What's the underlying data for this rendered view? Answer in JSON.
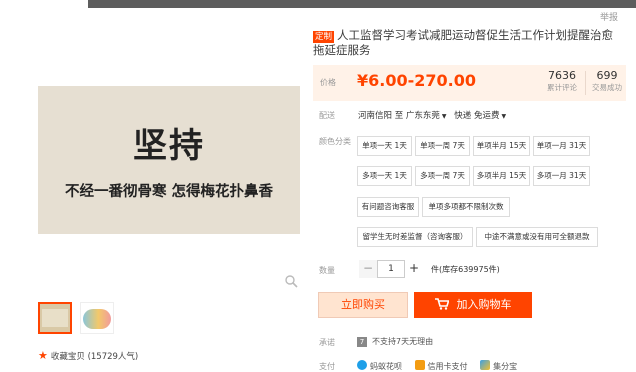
{
  "header": {
    "top_right_link": "举报"
  },
  "product": {
    "tag": "定制",
    "title": "人工监督学习考试减肥运动督促生活工作计划提醒治愈拖延症服务",
    "image": {
      "big_text": "坚持",
      "small_text": "不经一番彻骨寒 怎得梅花扑鼻香"
    },
    "favorite": "收藏宝贝 (15729人气)"
  },
  "price": {
    "label": "价格",
    "value": "¥6.00-270.00"
  },
  "stats": [
    {
      "num": "7636",
      "label": "累计评论"
    },
    {
      "num": "699",
      "label": "交易成功"
    }
  ],
  "shipping": {
    "label": "配送",
    "from": "河南信阳 至",
    "to": "广东东莞",
    "method": "快递 免运费"
  },
  "options": {
    "label": "颜色分类",
    "items": [
      "单项一天 1天",
      "单项一周 7天",
      "单项半月 15天",
      "单项一月 31天",
      "多项一天 1天",
      "多项一周 7天",
      "多项半月 15天",
      "多项一月 31天",
      "有问题咨询客服",
      "单项多项都不限制次数",
      "留学生无时差监督（咨询客服）",
      "中途不满意或没有用可全额退款"
    ]
  },
  "quantity": {
    "label": "数量",
    "value": "1",
    "minus": "−",
    "plus": "+",
    "stock": "件(库存639975件)"
  },
  "buttons": {
    "buy": "立即购买",
    "cart": "加入购物车"
  },
  "promise": {
    "label": "承诺",
    "badge": "7",
    "text": "不支持7天无理由"
  },
  "payment": {
    "label": "支付",
    "methods": [
      "蚂蚁花呗",
      "信用卡支付",
      "集分宝"
    ]
  },
  "colors": {
    "accent": "#ff4400",
    "price_bg": "#fff2e8"
  }
}
